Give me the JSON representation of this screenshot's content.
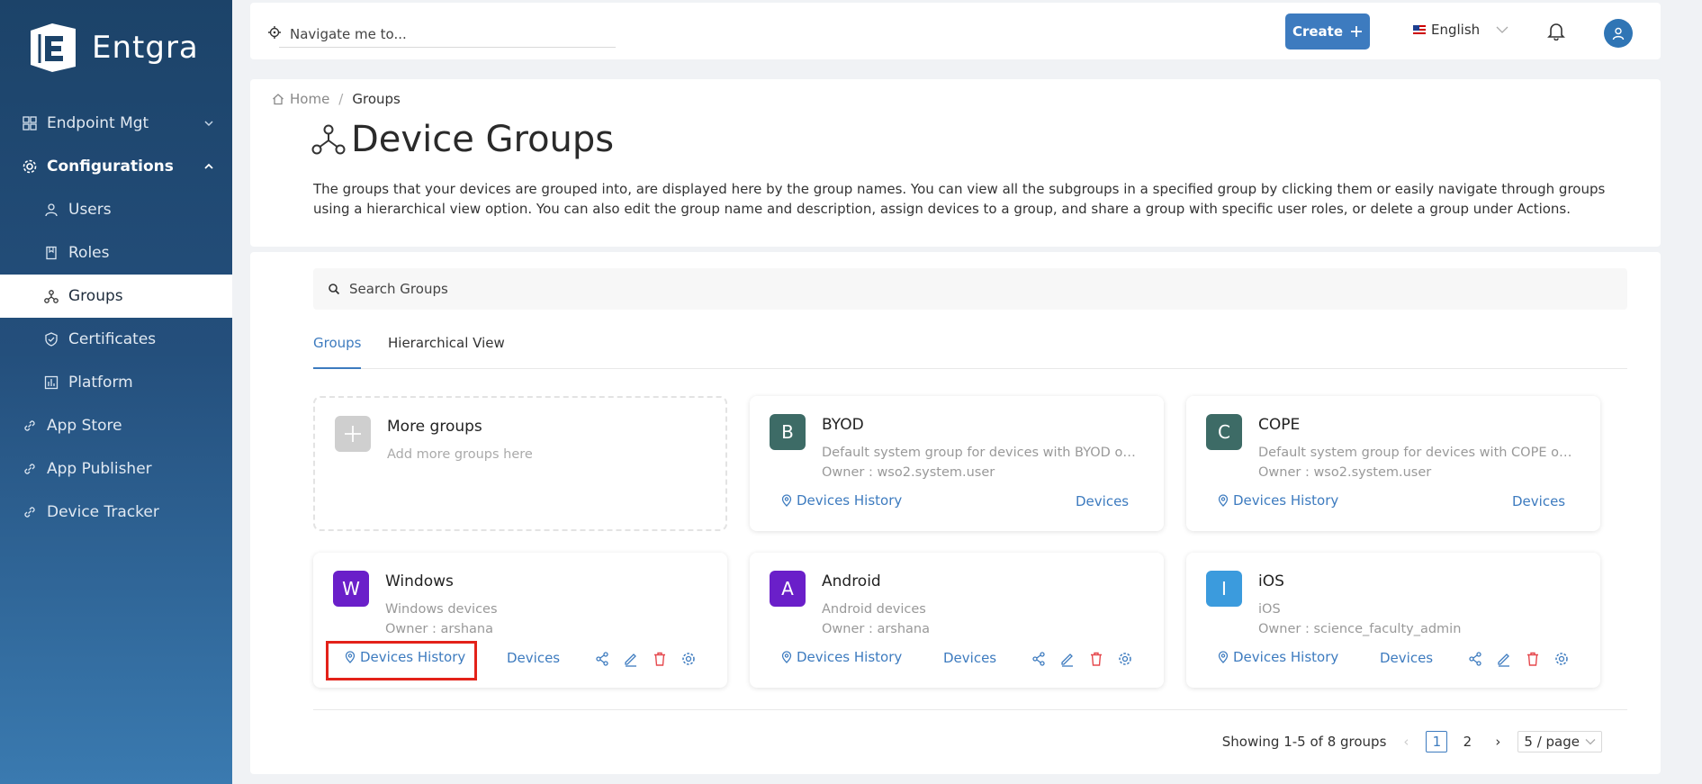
{
  "brand": {
    "name": "Entgra"
  },
  "sidebar": {
    "items": [
      {
        "label": "Endpoint Mgt",
        "icon": "grid-icon",
        "level": "top",
        "expandable": true,
        "expanded": false
      },
      {
        "label": "Configurations",
        "icon": "gear-icon",
        "level": "top",
        "expandable": true,
        "expanded": true
      },
      {
        "label": "Users",
        "icon": "user-icon",
        "level": "sub"
      },
      {
        "label": "Roles",
        "icon": "book-icon",
        "level": "sub"
      },
      {
        "label": "Groups",
        "icon": "group-icon",
        "level": "sub",
        "active": true
      },
      {
        "label": "Certificates",
        "icon": "shield-check-icon",
        "level": "sub"
      },
      {
        "label": "Platform",
        "icon": "chart-box-icon",
        "level": "sub"
      },
      {
        "label": "App Store",
        "icon": "link-icon",
        "level": "top"
      },
      {
        "label": "App Publisher",
        "icon": "link-icon",
        "level": "top"
      },
      {
        "label": "Device Tracker",
        "icon": "link-icon",
        "level": "top"
      }
    ]
  },
  "header": {
    "nav_placeholder": "Navigate me to...",
    "create_label": "Create",
    "language": "English"
  },
  "breadcrumb": {
    "home": "Home",
    "current": "Groups"
  },
  "page": {
    "title": "Device Groups",
    "description": "The groups that your devices are grouped into, are displayed here by the group names. You can view all the subgroups in a specified group by clicking them or easily navigate through groups using a hierarchical view option. You can also edit the group name and description, assign devices to a group, and share a group with specific user roles, or delete a group under Actions."
  },
  "search": {
    "placeholder": "Search Groups"
  },
  "tabs": [
    {
      "label": "Groups",
      "active": true
    },
    {
      "label": "Hierarchical View",
      "active": false
    }
  ],
  "more_groups": {
    "title": "More groups",
    "subtitle": "Add more groups here"
  },
  "groups": [
    {
      "initial": "B",
      "name": "BYOD",
      "description": "Default system group for devices with BYOD ownership.",
      "owner": "Owner : wso2.system.user",
      "color": "#3d6b66",
      "history_label": "Devices History",
      "devices_label": "Devices",
      "actions": false
    },
    {
      "initial": "C",
      "name": "COPE",
      "description": "Default system group for devices with COPE ownership.",
      "owner": "Owner : wso2.system.user",
      "color": "#3d6b66",
      "history_label": "Devices History",
      "devices_label": "Devices",
      "actions": false
    },
    {
      "initial": "W",
      "name": "Windows",
      "description": "Windows devices",
      "owner": "Owner : arshana",
      "color": "#6a1fc9",
      "history_label": "Devices History",
      "devices_label": "Devices",
      "actions": true,
      "highlighted": true
    },
    {
      "initial": "A",
      "name": "Android",
      "description": "Android devices",
      "owner": "Owner : arshana",
      "color": "#6a1fc9",
      "history_label": "Devices History",
      "devices_label": "Devices",
      "actions": true
    },
    {
      "initial": "I",
      "name": "iOS",
      "description": "iOS",
      "owner": "Owner : science_faculty_admin",
      "color": "#3b9bdd",
      "history_label": "Devices History",
      "devices_label": "Devices",
      "actions": true
    }
  ],
  "pagination": {
    "summary": "Showing 1-5 of 8 groups",
    "pages": [
      "1",
      "2"
    ],
    "current_page": "1",
    "page_size": "5 / page"
  },
  "colors": {
    "accent": "#3d7bbf",
    "delete": "#e5484d",
    "highlight": "#e32219"
  }
}
